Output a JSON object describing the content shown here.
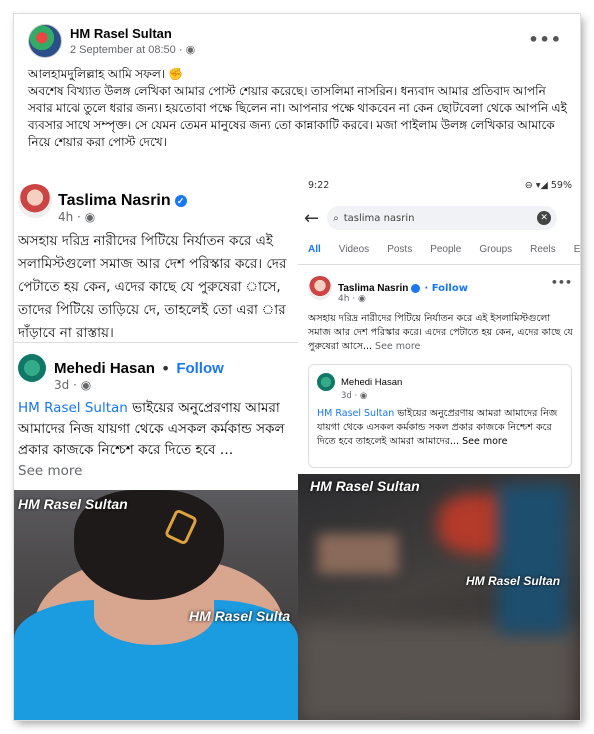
{
  "post": {
    "author": "HM Rasel Sultan",
    "timestamp": "2 September at 08:50 · ",
    "more": "•••",
    "caption_lines": [
      "আলহামদুলিল্লাহ আমি সফল। ✊",
      "অবশেষ বিখ্যাত উলঙ্গ লেখিকা  আমার পোস্ট শেয়ার করেছে। তাসলিমা নাসরিন। ধন্যবাদ আমার প্রতিবাদ আপনি সবার মাঝে তুলে ধরার জন্য। হয়তোবা পক্ষে ছিলেন না। আপনার পক্ষে থাকবেন না কেন ছোটবেলা থেকে আপনি এই ব্যবসার সাথে সম্পৃক্ত। সে যেমন তেমন মানুষের জন্য তো কান্নাকাটি করবে। মজা পাইলাম উলঙ্গ লেখিকার আমাকে নিয়ে শেয়ার করা পোস্ট দেখে।"
    ]
  },
  "left": {
    "name": "Taslima Nasrin",
    "time": "4h · ",
    "text": "অসহায় দরিদ্র নারীদের পিটিয়ে নির্যাতন করে এই সলামিস্টগুলো সমাজ আর দেশ পরিস্কার করে। দের পেটাতে হয় কেন, এদের কাছে যে পুরুষেরা াসে, তাদের পিটিয়ে তাড়িয়ে দে, তাহলেই তো এরা ার দাঁড়াবে না রাস্তায়।",
    "share_name": "Mehedi Hasan",
    "follow": "Follow",
    "share_time": "3d · ",
    "share_link": "HM Rasel Sultan",
    "share_text": " ভাইয়ের অনুপ্রেরণায় আমরা আমাদের নিজ যায়গা থেকে এসকল কর্মকান্ড সকল প্রকার কাজকে নিশ্চেশ করে দিতে হবে …",
    "see_more": "See more",
    "watermark1": "HM Rasel Sultan",
    "watermark2": "HM Rasel Sulta"
  },
  "right": {
    "status_time": "9:22",
    "status_icons": "⊖ ▾◢ 59%",
    "search_value": "taslima nasrin",
    "tabs": [
      "All",
      "Videos",
      "Posts",
      "People",
      "Groups",
      "Reels",
      "E"
    ],
    "name": "Taslima Nasrin",
    "follow": "Follow",
    "time": "4h · ",
    "more": "•••",
    "text": "অসহায় দরিদ্র নারীদের পিটিয়ে নির্যাতন করে এই ইসলামিস্টগুলো সমাজ আর দেশ পরিস্কার করে। এদের পেটাতে হয় কেন, এদের কাছে যে পুরুষেরা  আসে...",
    "see_more": " See more",
    "share_name": "Mehedi Hasan",
    "share_time": "3d · ",
    "share_link": "HM Rasel Sultan",
    "share_text": " ভাইয়ের অনুপ্রেরণায় আমরা আমাদের নিজ যায়গা থেকে এসকল কর্মকান্ড সকল প্রকার কাজকে নিশ্চেশ করে দিতে হবে তাহলেই আমরা আমাদের... See more",
    "watermark1": "HM Rasel Sultan",
    "watermark2": "HM Rasel Sultan"
  }
}
